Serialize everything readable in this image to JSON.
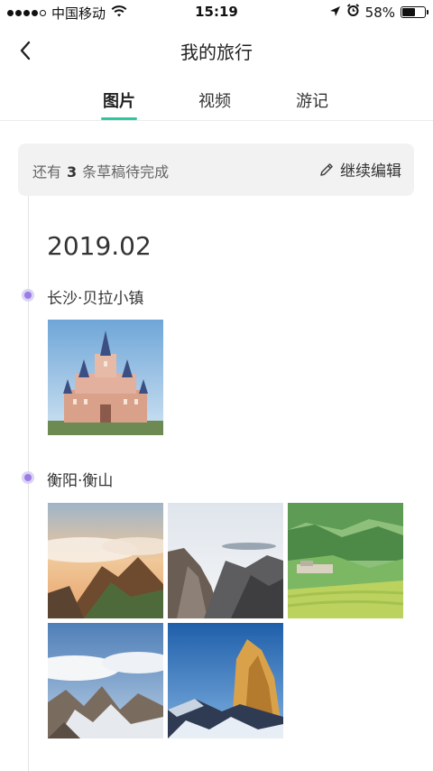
{
  "status_bar": {
    "carrier": "中国移动",
    "time": "15:19",
    "battery_percent": "58%",
    "battery_level": 0.58,
    "icons": [
      "signal-dots",
      "wifi-icon",
      "location-arrow-icon",
      "alarm-icon",
      "battery-icon"
    ]
  },
  "nav": {
    "title": "我的旅行",
    "back_icon": "chevron-left-icon"
  },
  "tabs": [
    {
      "label": "图片",
      "active": true
    },
    {
      "label": "视频",
      "active": false
    },
    {
      "label": "游记",
      "active": false
    }
  ],
  "draft": {
    "prefix": "还有",
    "count": "3",
    "suffix": "条草稿待完成",
    "action_label": "继续编辑",
    "action_icon": "pencil-icon"
  },
  "timeline": {
    "month": "2019.02",
    "groups": [
      {
        "location": "长沙·贝拉小镇",
        "photos": [
          "castle"
        ]
      },
      {
        "location": "衡阳·衡山",
        "photos": [
          "sunrise-clouds-peak",
          "misty-rocky-peaks",
          "green-terraced-hills",
          "snowy-mountain-clouds",
          "golden-rock-peak-snow"
        ]
      }
    ]
  },
  "colors": {
    "accent": "#2fc7a0",
    "timeline_dot": "#9b7be6",
    "timeline_dot_halo": "#d9d4f3"
  }
}
